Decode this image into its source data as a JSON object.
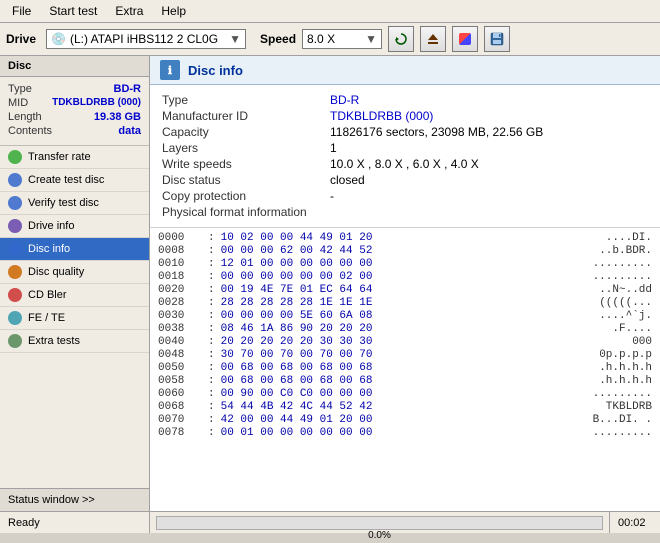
{
  "menubar": {
    "items": [
      "File",
      "Start test",
      "Extra",
      "Help"
    ]
  },
  "toolbar": {
    "drive_label": "Drive",
    "drive_icon": "💿",
    "drive_value": "(L:)  ATAPI iHBS112  2 CL0G",
    "speed_label": "Speed",
    "speed_value": "8.0 X",
    "btn_refresh": "↺",
    "btn_eject": "⏏",
    "btn_record": "🔴",
    "btn_save": "💾"
  },
  "sidebar": {
    "disc_header": "Disc",
    "disc_type_label": "Type",
    "disc_type_value": "BD-R",
    "disc_mid_label": "MID",
    "disc_mid_value": "TDKBLDRBB (000)",
    "disc_length_label": "Length",
    "disc_length_value": "19.38 GB",
    "disc_contents_label": "Contents",
    "disc_contents_value": "data",
    "nav_items": [
      {
        "id": "transfer-rate",
        "label": "Transfer rate",
        "icon": "📈"
      },
      {
        "id": "create-test-disc",
        "label": "Create test disc",
        "icon": "📀"
      },
      {
        "id": "verify-test-disc",
        "label": "Verify test disc",
        "icon": "✔"
      },
      {
        "id": "drive-info",
        "label": "Drive info",
        "icon": "🖴"
      },
      {
        "id": "disc-info",
        "label": "Disc info",
        "icon": "ℹ",
        "active": true
      },
      {
        "id": "disc-quality",
        "label": "Disc quality",
        "icon": "⭐"
      },
      {
        "id": "cd-bler",
        "label": "CD Bler",
        "icon": "📊"
      },
      {
        "id": "fe-te",
        "label": "FE / TE",
        "icon": "📉"
      },
      {
        "id": "extra-tests",
        "label": "Extra tests",
        "icon": "🔧"
      }
    ],
    "status_window_label": "Status window >>",
    "status_text": "Ready"
  },
  "content": {
    "header_icon": "i",
    "header_title": "Disc info",
    "fields": [
      {
        "label": "Type",
        "value": "BD-R",
        "blue": true
      },
      {
        "label": "Manufacturer ID",
        "value": "TDKBLDRBB (000)",
        "blue": true
      },
      {
        "label": "Capacity",
        "value": "11826176 sectors, 23098 MB, 22.56 GB",
        "blue": false
      },
      {
        "label": "Layers",
        "value": "1",
        "blue": false
      },
      {
        "label": "Write speeds",
        "value": "10.0 X , 8.0 X , 6.0 X , 4.0 X",
        "blue": false
      },
      {
        "label": "Disc status",
        "value": "closed",
        "blue": false
      },
      {
        "label": "Copy protection",
        "value": "-",
        "blue": false
      },
      {
        "label": "Physical format information",
        "value": "",
        "blue": false
      }
    ],
    "hex_rows": [
      {
        "addr": "0000",
        "bytes": "10 02 00 00  44 49 01 20",
        "ascii": "....DI."
      },
      {
        "addr": "0008",
        "bytes": "00 00 00 62  00 42 44 52",
        "ascii": "..b.BDR."
      },
      {
        "addr": "0010",
        "bytes": "12 01 00 00  00 00 00 00",
        "ascii": "........."
      },
      {
        "addr": "0018",
        "bytes": "00 00 00 00  00 00 02 00",
        "ascii": "........."
      },
      {
        "addr": "0020",
        "bytes": "00 19 4E 7E  01 EC 64 64",
        "ascii": "..N~..dd"
      },
      {
        "addr": "0028",
        "bytes": "28 28 28 28  28 1E 1E 1E",
        "ascii": "(((((..."
      },
      {
        "addr": "0030",
        "bytes": "00 00 00 00  5E 60 6A 08",
        "ascii": "....^`j."
      },
      {
        "addr": "0038",
        "bytes": "08 46 1A 86  90 20 20 20",
        "ascii": ".F....   "
      },
      {
        "addr": "0040",
        "bytes": "20 20 20 20  20 30 30 30",
        "ascii": "     000"
      },
      {
        "addr": "0048",
        "bytes": "30 70 00 70  00 70 00 70",
        "ascii": "0p.p.p.p"
      },
      {
        "addr": "0050",
        "bytes": "00 68 00 68  00 68 00 68",
        "ascii": ".h.h.h.h"
      },
      {
        "addr": "0058",
        "bytes": "00 68 00 68  00 68 00 68",
        "ascii": ".h.h.h.h"
      },
      {
        "addr": "0060",
        "bytes": "00 90 00 C0  C0 00 00 00",
        "ascii": "........."
      },
      {
        "addr": "0068",
        "bytes": "54 44 4B 42  4C 44 52 42",
        "ascii": "TKBLDRB"
      },
      {
        "addr": "0070",
        "bytes": "42 00 00 44  49 01 20 00",
        "ascii": "B...DI. ."
      },
      {
        "addr": "0078",
        "bytes": "00 01 00 00  00 00 00 00",
        "ascii": "........."
      }
    ]
  },
  "statusbar": {
    "status_text": "Ready",
    "progress_percent": "0.0%",
    "time": "00:02"
  }
}
